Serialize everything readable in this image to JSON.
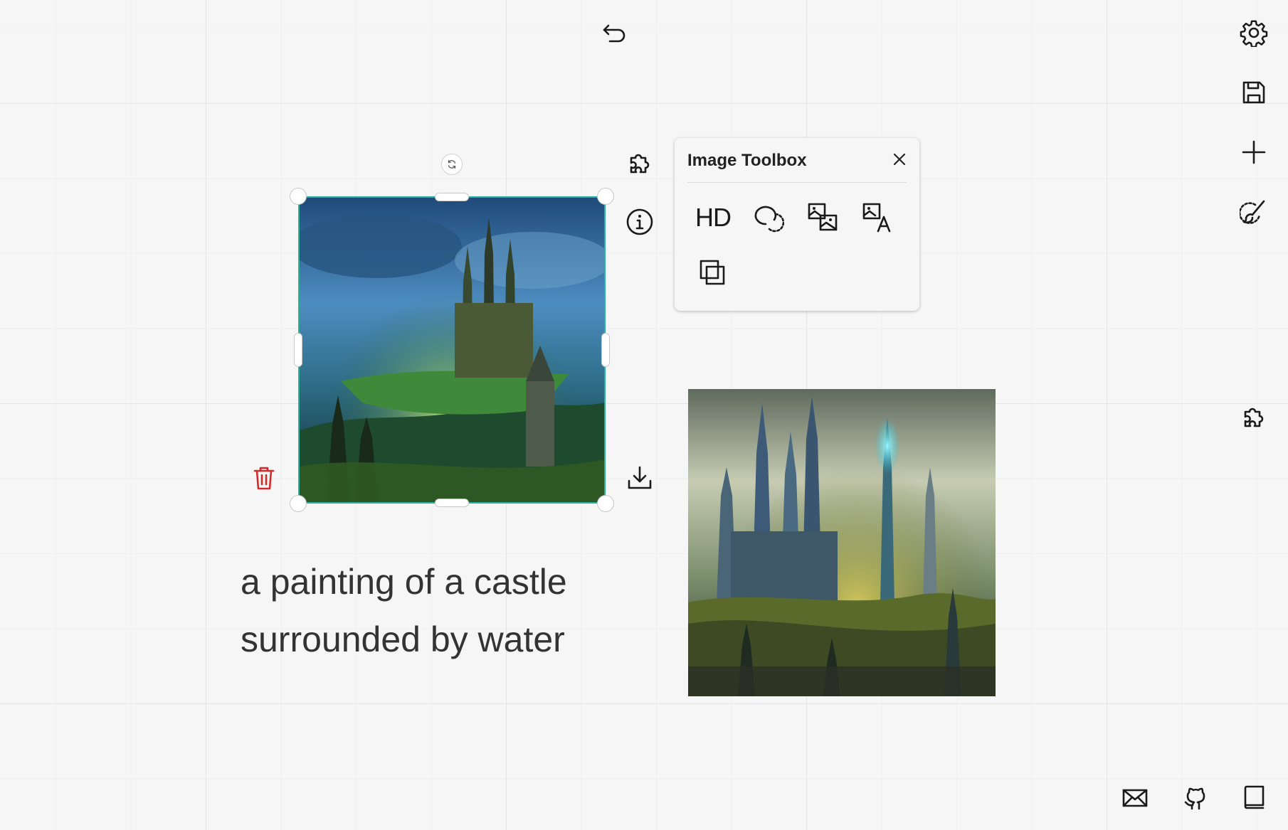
{
  "top": {
    "undo_icon": "undo-icon"
  },
  "right_toolbar": {
    "icons": [
      "gear-icon",
      "save-icon",
      "plus-icon",
      "brush-icon",
      "puzzle-icon"
    ]
  },
  "bottom_toolbar": {
    "icons": [
      "mail-icon",
      "github-icon",
      "book-icon"
    ]
  },
  "selected_image": {
    "actions": [
      "puzzle-icon",
      "info-icon",
      "download-icon",
      "trash-icon",
      "rotate-icon"
    ],
    "colors": {
      "selection": "#2bb39a",
      "delete": "#d42a2a"
    }
  },
  "toolbox": {
    "title": "Image Toolbox",
    "tools": [
      "hd-icon",
      "lasso-icon",
      "image-to-image-icon",
      "image-to-text-icon",
      "copy-icon"
    ],
    "hd_label": "HD"
  },
  "caption": {
    "line1": "a painting of a castle",
    "line2": "surrounded by water"
  }
}
